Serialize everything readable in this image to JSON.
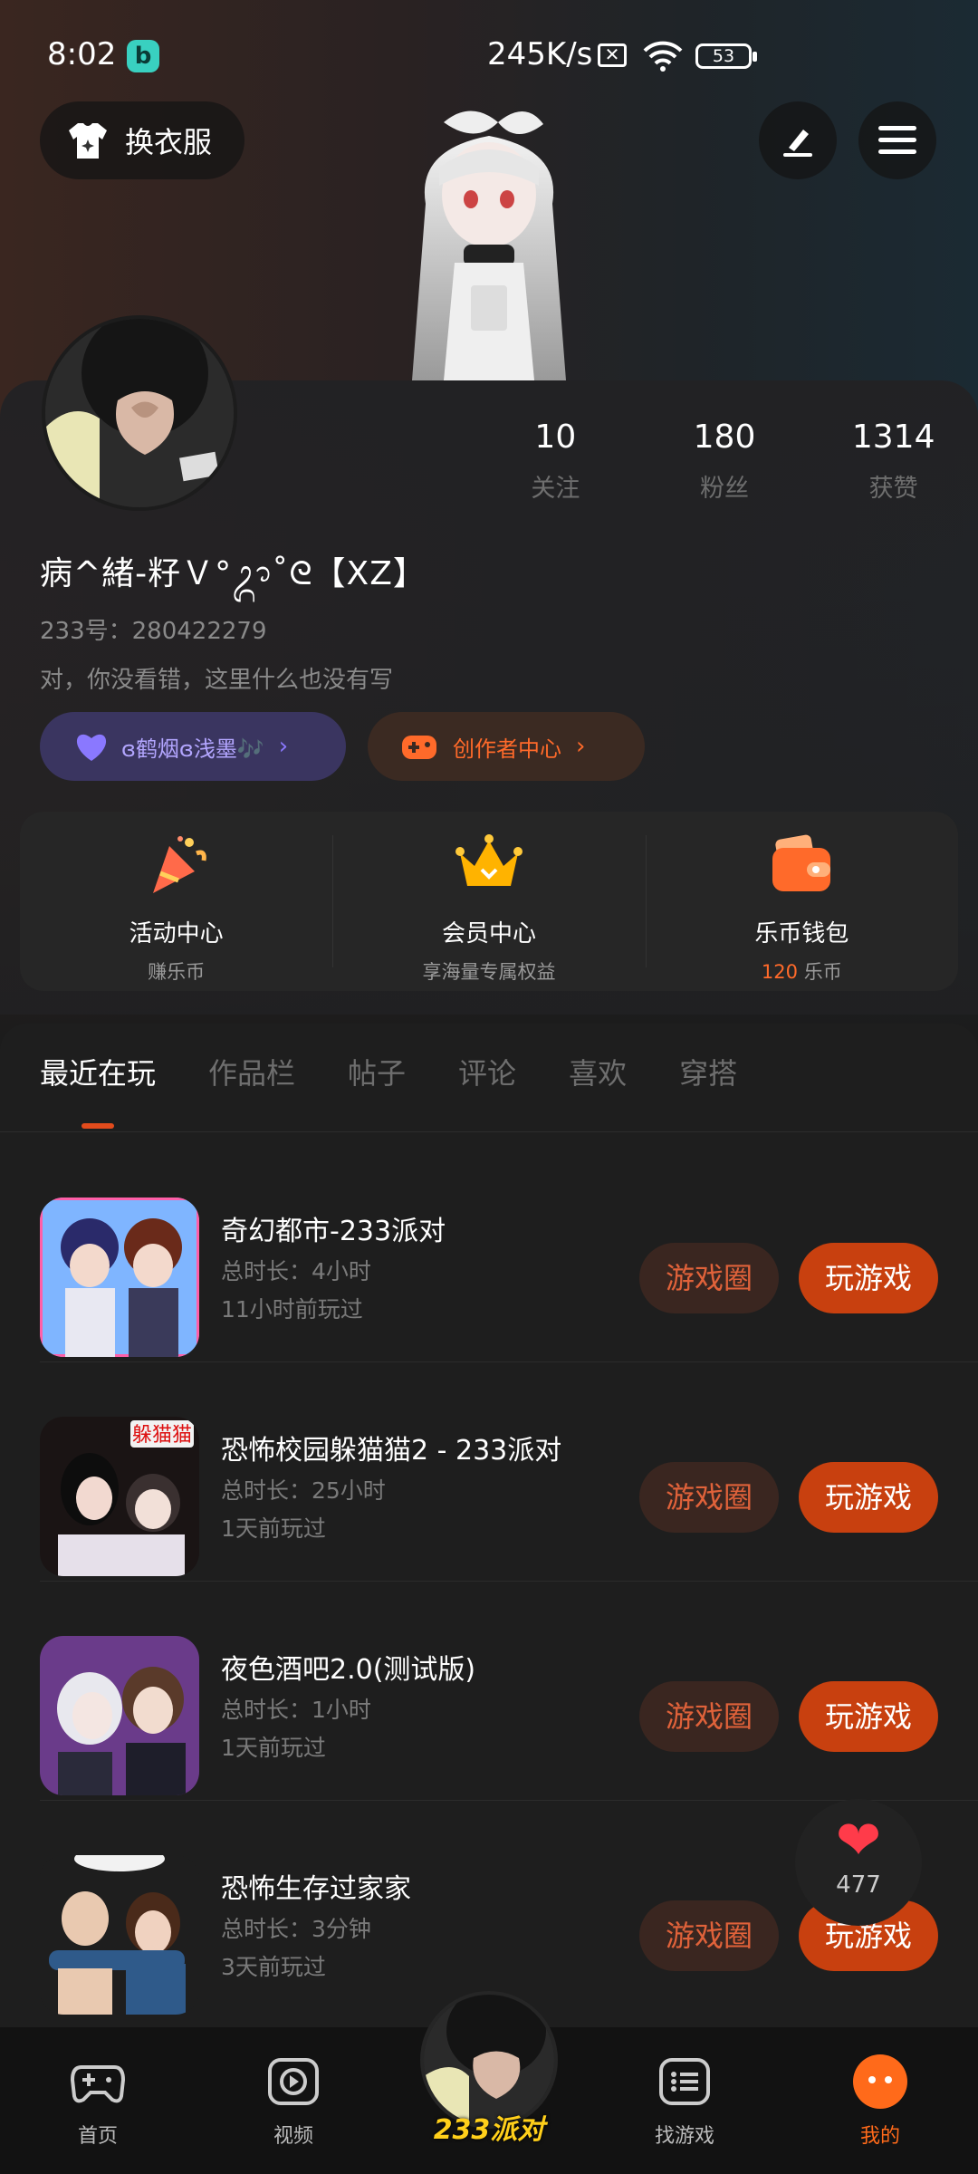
{
  "status_bar": {
    "time": "8:02",
    "app_badge": "b",
    "speed": "245K/s",
    "battery": "53"
  },
  "header": {
    "dress_label": "换衣服"
  },
  "profile": {
    "stats": [
      {
        "value": "10",
        "label": "关注"
      },
      {
        "value": "180",
        "label": "粉丝"
      },
      {
        "value": "1314",
        "label": "获赞"
      }
    ],
    "nickname": "病^緒-籽Ｖ°ᬊ˚ᘓ【XZ】",
    "uid": "233号：280422279",
    "bio": "对，你没看错，这里什么也没有写",
    "chip_group": "ɞ鹤烟ɞ浅墨🎶",
    "chip_creator": "创作者中心"
  },
  "features": [
    {
      "title": "活动中心",
      "sub": "赚乐币"
    },
    {
      "title": "会员中心",
      "sub": "享海量专属权益"
    },
    {
      "title": "乐币钱包",
      "sub_value": "120",
      "sub_unit": "乐币"
    }
  ],
  "tabs": [
    "最近在玩",
    "作品栏",
    "帖子",
    "评论",
    "喜欢",
    "穿搭"
  ],
  "games": [
    {
      "name": "奇幻都市-233派对",
      "duration": "总时长：4小时",
      "last": "11小时前玩过"
    },
    {
      "name": "恐怖校园躲猫猫2 - 233派对",
      "duration": "总时长：25小时",
      "last": "1天前玩过"
    },
    {
      "name": "夜色酒吧2.0(测试版)",
      "duration": "总时长：1小时",
      "last": "1天前玩过"
    },
    {
      "name": "恐怖生存过家家",
      "duration": "总时长：3分钟",
      "last": "3天前玩过"
    }
  ],
  "game_buttons": {
    "circle": "游戏圈",
    "play": "玩游戏"
  },
  "game2_thumb_text": "躲猫猫",
  "float_like": {
    "count": "477"
  },
  "bottom_nav": {
    "home": "首页",
    "video": "视频",
    "center": "233派对",
    "find": "找游戏",
    "mine": "我的"
  },
  "colors": {
    "accent": "#ff6a1a",
    "play_button": "#c8400f",
    "circle_button_bg": "#3a2620"
  }
}
